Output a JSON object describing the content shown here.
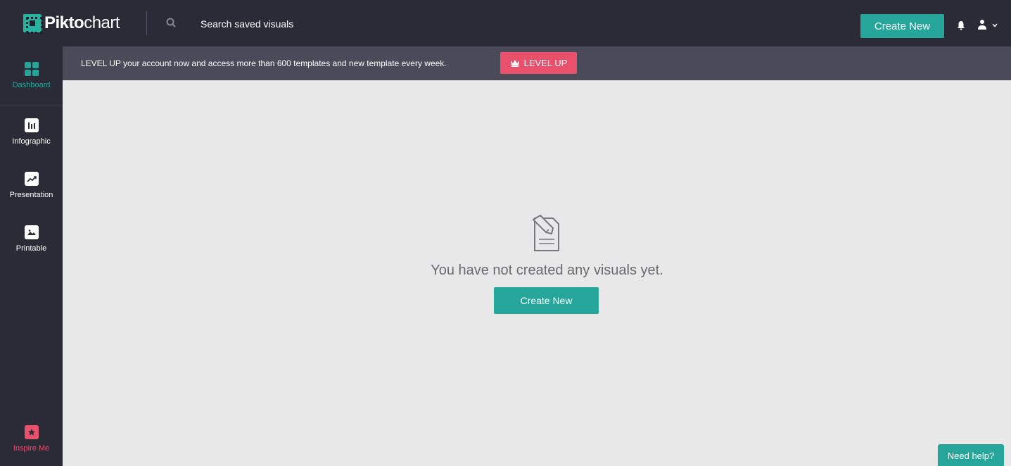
{
  "app": {
    "logo_bold": "Pikto",
    "logo_light": "chart",
    "brand_color": "#26a69a",
    "accent_pink": "#e8506b"
  },
  "header": {
    "search_placeholder": "Search saved visuals",
    "create_label": "Create New",
    "icons": [
      "search-icon",
      "bell-icon",
      "user-icon",
      "chevron-down-icon"
    ]
  },
  "sidebar": {
    "items": [
      {
        "label": "Dashboard",
        "icon": "dashboard-grid-icon",
        "active": true
      },
      {
        "label": "Infographic",
        "icon": "bar-chart-icon"
      },
      {
        "label": "Presentation",
        "icon": "trend-chart-icon"
      },
      {
        "label": "Printable",
        "icon": "image-icon"
      },
      {
        "label": "Inspire Me",
        "icon": "star-icon"
      }
    ]
  },
  "banner": {
    "text": "LEVEL UP your account now and access more than 600 templates and new template every week.",
    "button_label": "LEVEL UP",
    "button_icon": "crown-icon"
  },
  "main": {
    "empty_icon": "document-edit-icon",
    "empty_message": "You have not created any visuals yet.",
    "create_label": "Create New"
  },
  "help": {
    "label": "Need help?"
  }
}
